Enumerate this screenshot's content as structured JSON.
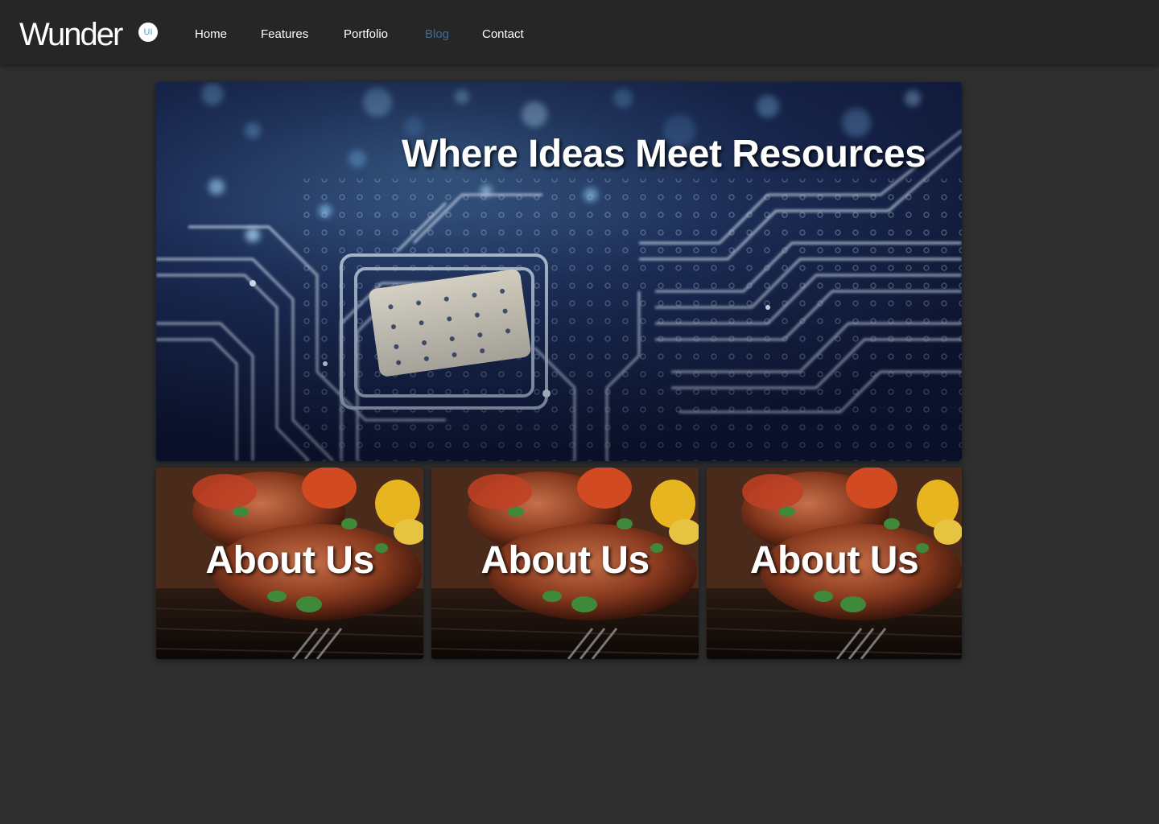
{
  "brand": {
    "name": "Wunder",
    "badge": "UI"
  },
  "nav": {
    "items": [
      {
        "label": "Home"
      },
      {
        "label": "Features"
      },
      {
        "label": "Portfolio"
      },
      {
        "label": "Blog",
        "active": true
      },
      {
        "label": "Contact"
      }
    ]
  },
  "hero": {
    "title": "Where Ideas Meet Resources",
    "image": "circuit-board-image"
  },
  "cards": [
    {
      "title": "About Us",
      "image": "grilled-steak-image"
    },
    {
      "title": "About Us",
      "image": "grilled-steak-image"
    },
    {
      "title": "About Us",
      "image": "grilled-steak-image"
    }
  ],
  "colors": {
    "page_bg": "#2f2f2f",
    "navbar_bg": "#262626",
    "nav_text": "#ffffff",
    "nav_active": "#3c6d97",
    "badge_text": "#4aa3d8"
  }
}
